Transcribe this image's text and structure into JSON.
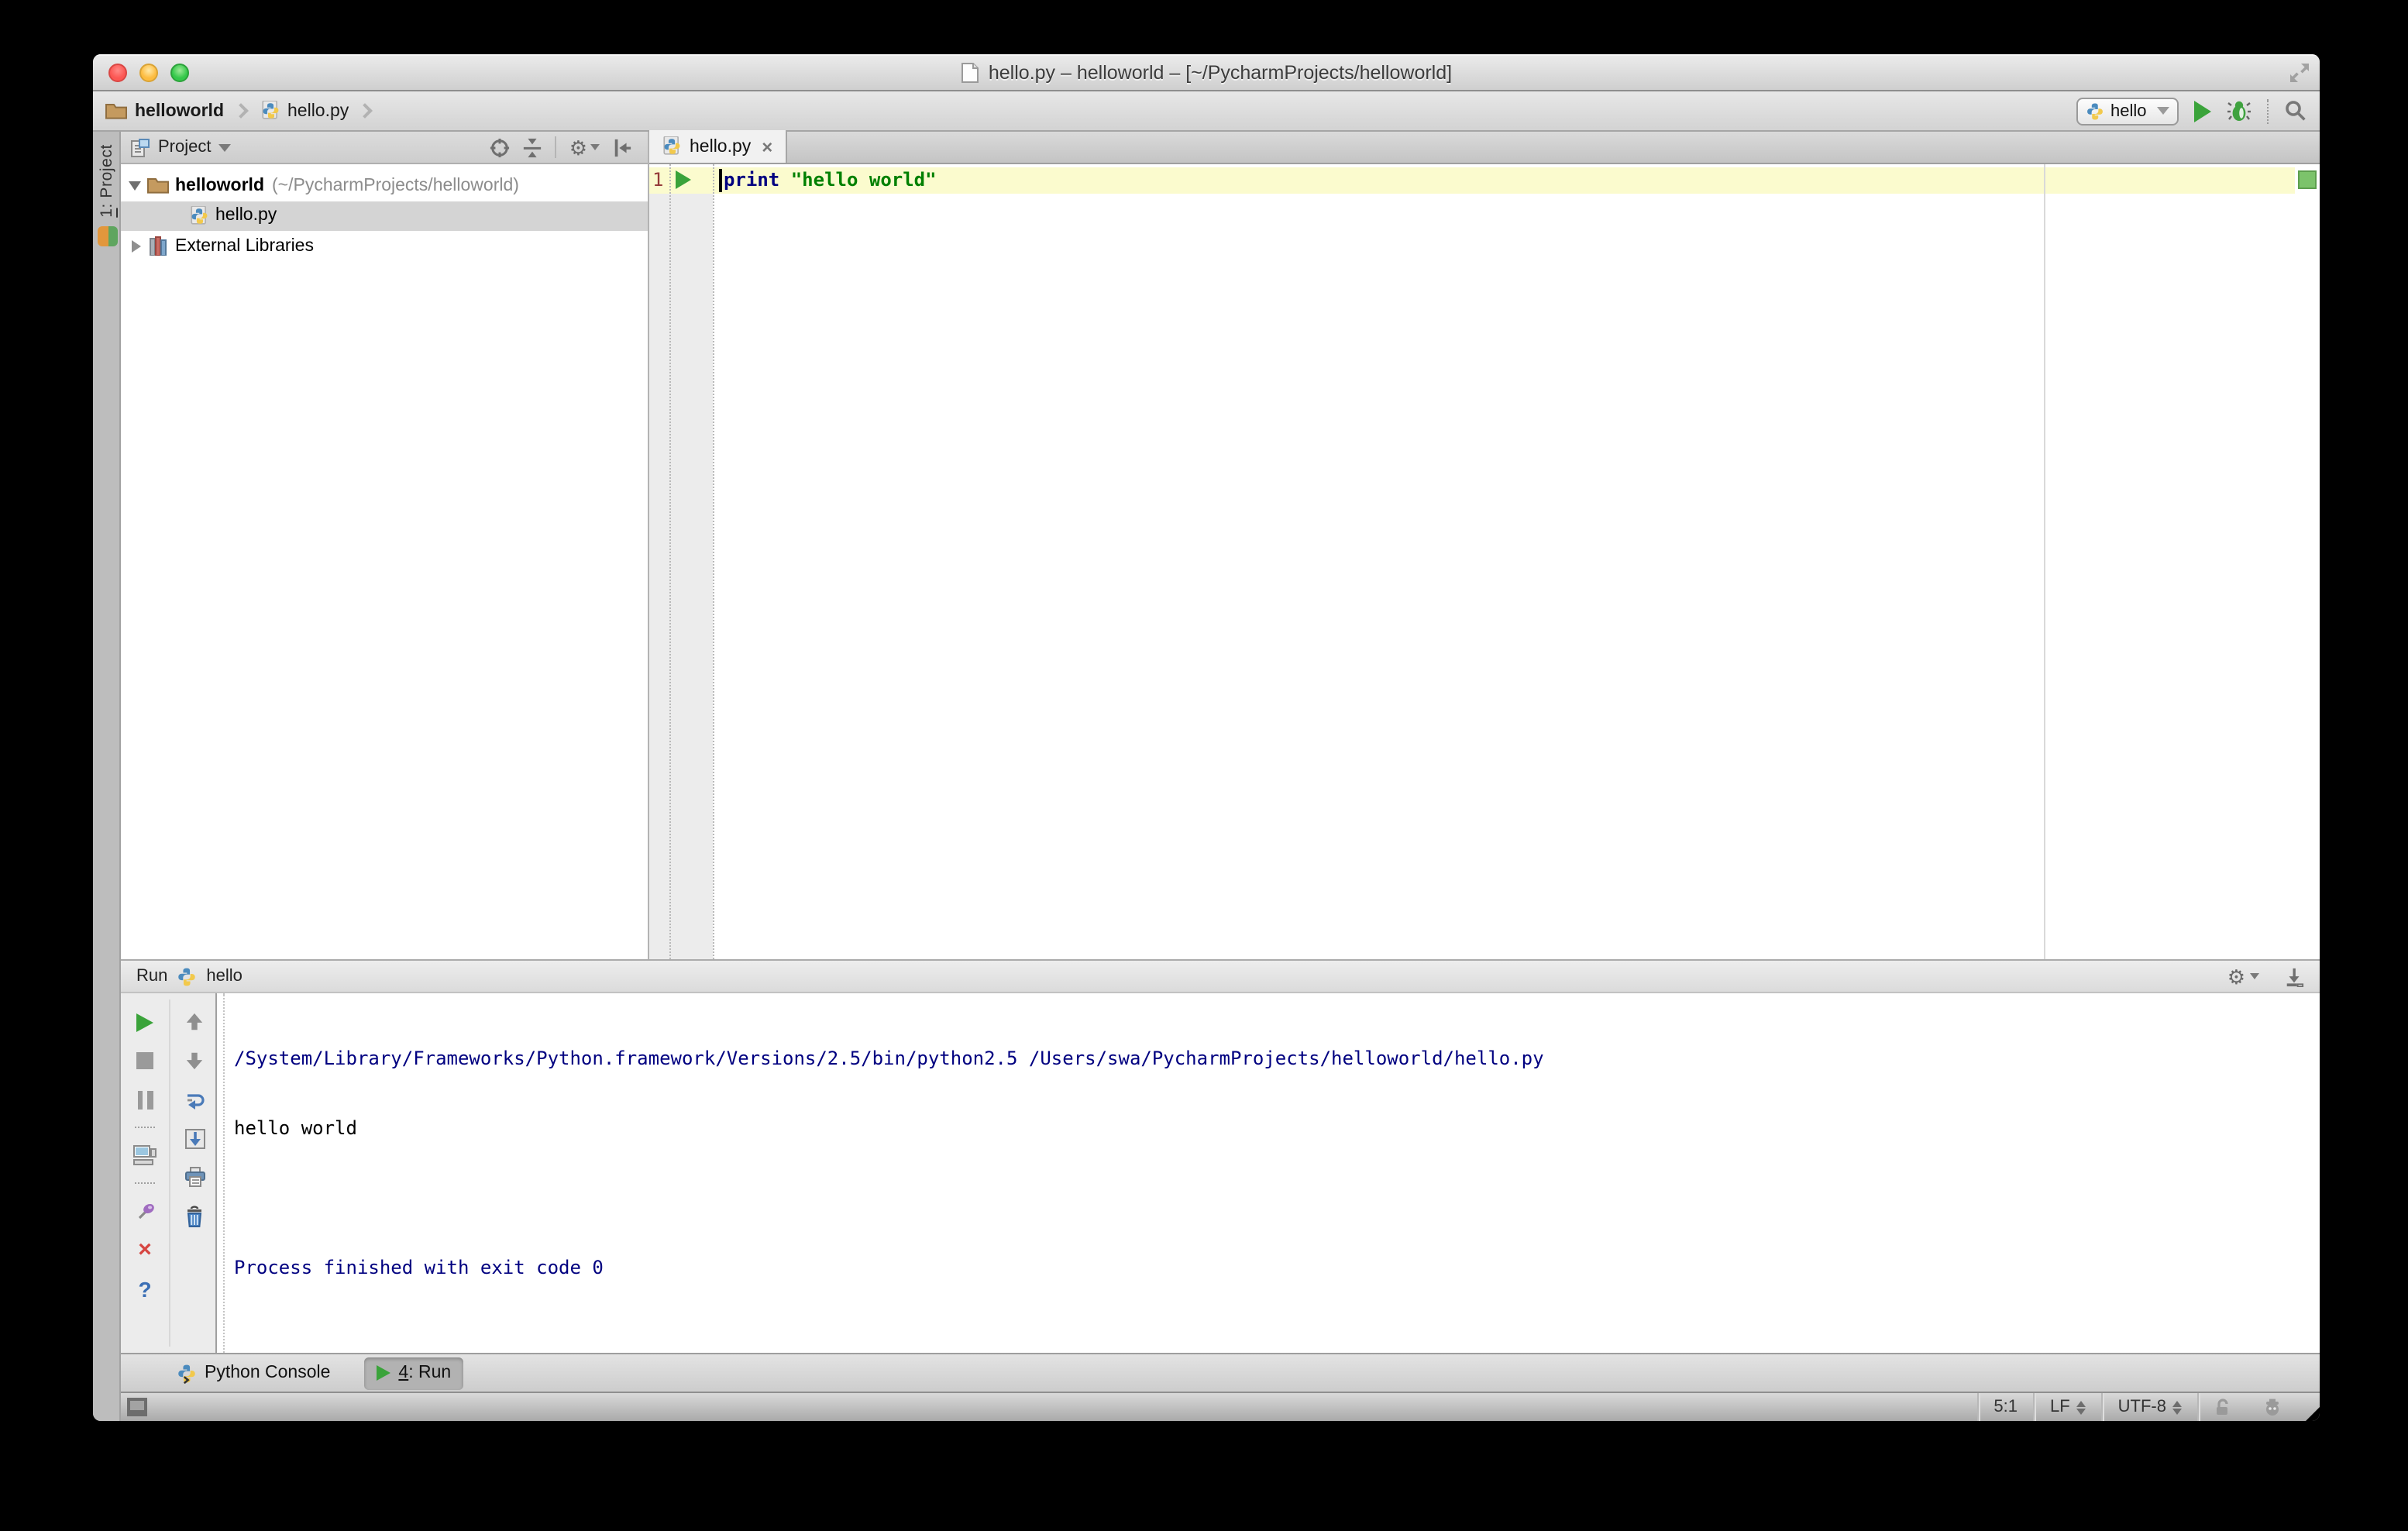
{
  "window": {
    "title": "hello.py – helloworld – [~/PycharmProjects/helloworld]"
  },
  "toolbar": {
    "breadcrumbs": [
      {
        "label": "helloworld",
        "icon": "folder-icon"
      },
      {
        "label": "hello.py",
        "icon": "python-file-icon"
      }
    ],
    "run_config_name": "hello"
  },
  "project_panel": {
    "header_label": "Project",
    "tool_button": {
      "prefix": "1",
      "rest": ": Project"
    },
    "tree": [
      {
        "label": "helloworld",
        "path": "(~/PycharmProjects/helloworld)",
        "icon": "folder-icon",
        "expanded": true,
        "selected": false
      },
      {
        "label": "hello.py",
        "icon": "python-file-icon",
        "selected": true
      },
      {
        "label": "External Libraries",
        "icon": "libraries-icon",
        "expanded": false,
        "selected": false
      }
    ]
  },
  "editor": {
    "tab_label": "hello.py",
    "line_number": "1",
    "code": {
      "keyword": "print",
      "string": "\"hello world\""
    }
  },
  "run_panel": {
    "title": "Run",
    "config_name": "hello",
    "console_lines": [
      "/System/Library/Frameworks/Python.framework/Versions/2.5/bin/python2.5 /Users/swa/PycharmProjects/helloworld/hello.py",
      "hello world",
      "",
      "Process finished with exit code 0"
    ]
  },
  "toolwindow_bar": {
    "python_console_label": "Python Console",
    "run_button": {
      "prefix": "4",
      "rest": ": Run"
    }
  },
  "status_bar": {
    "caret_position": "5:1",
    "line_separator": "LF",
    "encoding": "UTF-8"
  },
  "colors": {
    "current_line_highlight": "#FBFBCE",
    "keyword": "#000080",
    "string": "#008000",
    "console_info": "#000080",
    "tree_selection": "#D4D4D4",
    "inspection_ok_indicator": "#7CC36B",
    "run_green": "#3AA33A",
    "close_red": "#D64541",
    "help_blue": "#3B6FB5"
  },
  "icons": {
    "traffic-lights": "close / minimize / zoom",
    "search-icon": "magnifier",
    "debug-icon": "green bug",
    "run-icon": "green triangle",
    "settings-icon": "gear",
    "locate-icon": "crosshair target",
    "collapse-all-icon": "arrows to line",
    "hide-panel-icon": "arrow to bar",
    "soft-wrap-icon": "wrapping arrow",
    "scroll-end-icon": "arrow into frame",
    "print-icon": "printer",
    "clear-icon": "trash can",
    "pin-icon": "purple pin",
    "lock-icon": "open padlock",
    "hector-icon": "inspector profile"
  }
}
